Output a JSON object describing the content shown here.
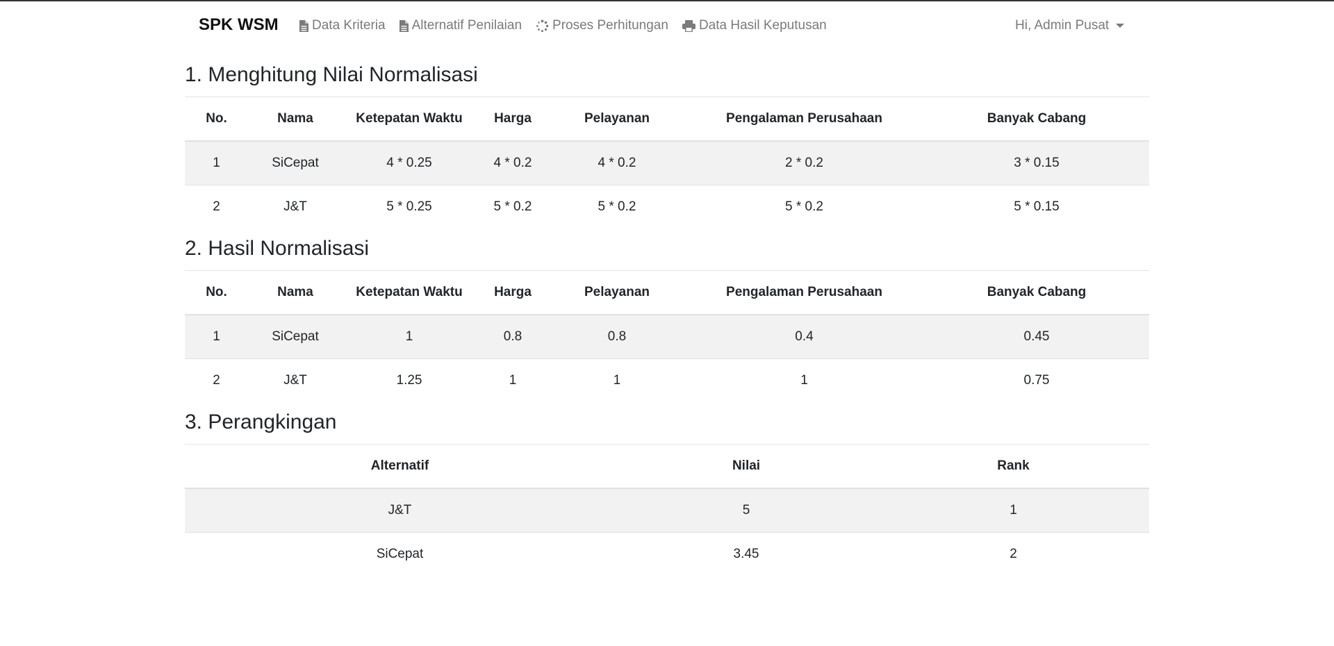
{
  "nav": {
    "brand": "SPK WSM",
    "items": [
      {
        "label": "Data Kriteria",
        "icon": "file-icon"
      },
      {
        "label": "Alternatif Penilaian",
        "icon": "file-icon"
      },
      {
        "label": "Proses Perhitungan",
        "icon": "spinner-icon"
      },
      {
        "label": "Data Hasil Keputusan",
        "icon": "print-icon"
      }
    ],
    "user": "Hi, Admin Pusat"
  },
  "section1": {
    "title": "1. Menghitung Nilai Normalisasi",
    "headers": [
      "No.",
      "Nama",
      "Ketepatan Waktu",
      "Harga",
      "Pelayanan",
      "Pengalaman Perusahaan",
      "Banyak Cabang"
    ],
    "rows": [
      [
        "1",
        "SiCepat",
        "4 * 0.25",
        "4 * 0.2",
        "4 * 0.2",
        "2 * 0.2",
        "3 * 0.15"
      ],
      [
        "2",
        "J&T",
        "5 * 0.25",
        "5 * 0.2",
        "5 * 0.2",
        "5 * 0.2",
        "5 * 0.15"
      ]
    ]
  },
  "section2": {
    "title": "2. Hasil Normalisasi",
    "headers": [
      "No.",
      "Nama",
      "Ketepatan Waktu",
      "Harga",
      "Pelayanan",
      "Pengalaman Perusahaan",
      "Banyak Cabang"
    ],
    "rows": [
      [
        "1",
        "SiCepat",
        "1",
        "0.8",
        "0.8",
        "0.4",
        "0.45"
      ],
      [
        "2",
        "J&T",
        "1.25",
        "1",
        "1",
        "1",
        "0.75"
      ]
    ]
  },
  "section3": {
    "title": "3. Perangkingan",
    "headers": [
      "Alternatif",
      "Nilai",
      "Rank"
    ],
    "rows": [
      [
        "J&T",
        "5",
        "1"
      ],
      [
        "SiCepat",
        "3.45",
        "2"
      ]
    ]
  }
}
